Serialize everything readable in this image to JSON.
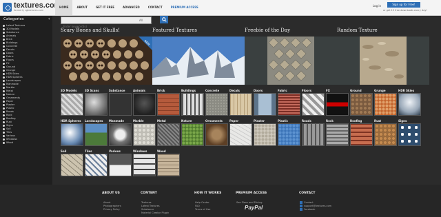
{
  "header": {
    "logo_text": "textures.com",
    "logo_tagline": "formerly cgtextures.com",
    "nav": [
      "HOME",
      "ABOUT",
      "GET IT FREE",
      "ADVANCED",
      "CONTACT",
      "PREMIUM ACCESS"
    ],
    "search_placeholder": "Enter keyword(s)",
    "search_select": "All",
    "login": "Log in",
    "signup": "Sign up for Free!",
    "signup_sub": "or get 15 free downloads every day!"
  },
  "sidebar": {
    "heading": "Categories",
    "items": [
      "Latest Textures",
      "3D Models",
      "Substance",
      "Animals",
      "Brick",
      "Buildings",
      "Concrete",
      "Decals",
      "Doors",
      "Fabric",
      "Floors",
      "FX",
      "Ground",
      "Grunge",
      "HDR Skies",
      "HDR Spheres",
      "Landscapes",
      "Manmade",
      "Marble",
      "Metal",
      "Nature",
      "Ornaments",
      "Paper",
      "Plaster",
      "Plastic",
      "Roads",
      "Rock",
      "Roofing",
      "Rust",
      "Signs",
      "Soil",
      "Tiles",
      "Various",
      "Windows",
      "Wood"
    ]
  },
  "featured": [
    {
      "title": "Scary Bones and Skulls!",
      "badge": "NEW"
    },
    {
      "title": "Featured Textures"
    },
    {
      "title": "Freebie of the Day"
    },
    {
      "title": "Random Texture"
    }
  ],
  "categories": [
    "3D Models",
    "3D Scans",
    "Substance",
    "Animals",
    "Brick",
    "Buildings",
    "Concrete",
    "Decals",
    "Doors",
    "Fabric",
    "Floors",
    "FX",
    "Ground",
    "Grunge",
    "HDR Skies",
    "HDR Spheres",
    "Landscapes",
    "Manmade",
    "Marble",
    "Metal",
    "Nature",
    "Ornaments",
    "Paper",
    "Plaster",
    "Plastic",
    "Roads",
    "Rock",
    "Roofing",
    "Rust",
    "Signs",
    "Soil",
    "Tiles",
    "Various",
    "Windows",
    "Wood"
  ],
  "footer": {
    "about": {
      "heading": "ABOUT US",
      "links": [
        "About",
        "Photographers",
        "Privacy Policy"
      ]
    },
    "content": {
      "heading": "CONTENT",
      "links": [
        "Textures",
        "Latest Textures",
        "Substance",
        "Material Creator Plugin"
      ]
    },
    "how": {
      "heading": "HOW IT WORKS",
      "links": [
        "Help Center",
        "FAQ",
        "Terms of Use"
      ]
    },
    "premium": {
      "heading": "PREMIUM ACCESS",
      "links": [
        "See Plans and Pricing"
      ],
      "paypal": "PayPal"
    },
    "contact": {
      "heading": "CONTACT",
      "links": [
        "Contact",
        "support@textures.com",
        "Facebook"
      ]
    }
  }
}
